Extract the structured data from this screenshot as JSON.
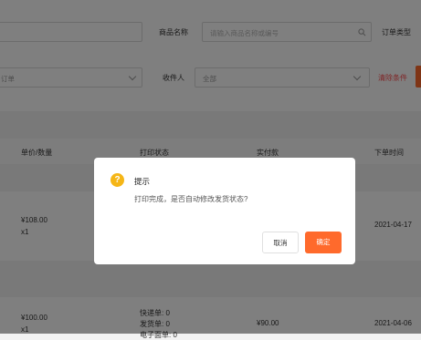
{
  "filters": {
    "product_name_label": "商品名称",
    "product_name_placeholder": "请输入商品名称或编号",
    "order_type_label": "订单类型",
    "partial_select_value": "订单",
    "recipient_label": "收件人",
    "recipient_value": "全部",
    "clear_label": "清除条件"
  },
  "table": {
    "headers": {
      "price_qty": "单价/数量",
      "print_status": "打印状态",
      "paid": "实付款",
      "order_time": "下单时间"
    },
    "rows": [
      {
        "price": "¥108.00",
        "qty": "x1",
        "time": "2021-04-17"
      },
      {
        "price": "¥100.00",
        "qty": "x1",
        "print_lines": [
          "快递单: 0",
          "发货单: 0",
          "电子面单: 0"
        ],
        "paid": "¥90.00",
        "time": "2021-04-06"
      }
    ]
  },
  "dialog": {
    "title": "提示",
    "message": "打印完成，是否自动修改发货状态?",
    "cancel_label": "取消",
    "confirm_label": "确定",
    "icon_glyph": "?"
  },
  "colors": {
    "accent": "#ff6a2c",
    "warning_icon": "#f5b617",
    "clear_link": "#ff4d4f"
  }
}
